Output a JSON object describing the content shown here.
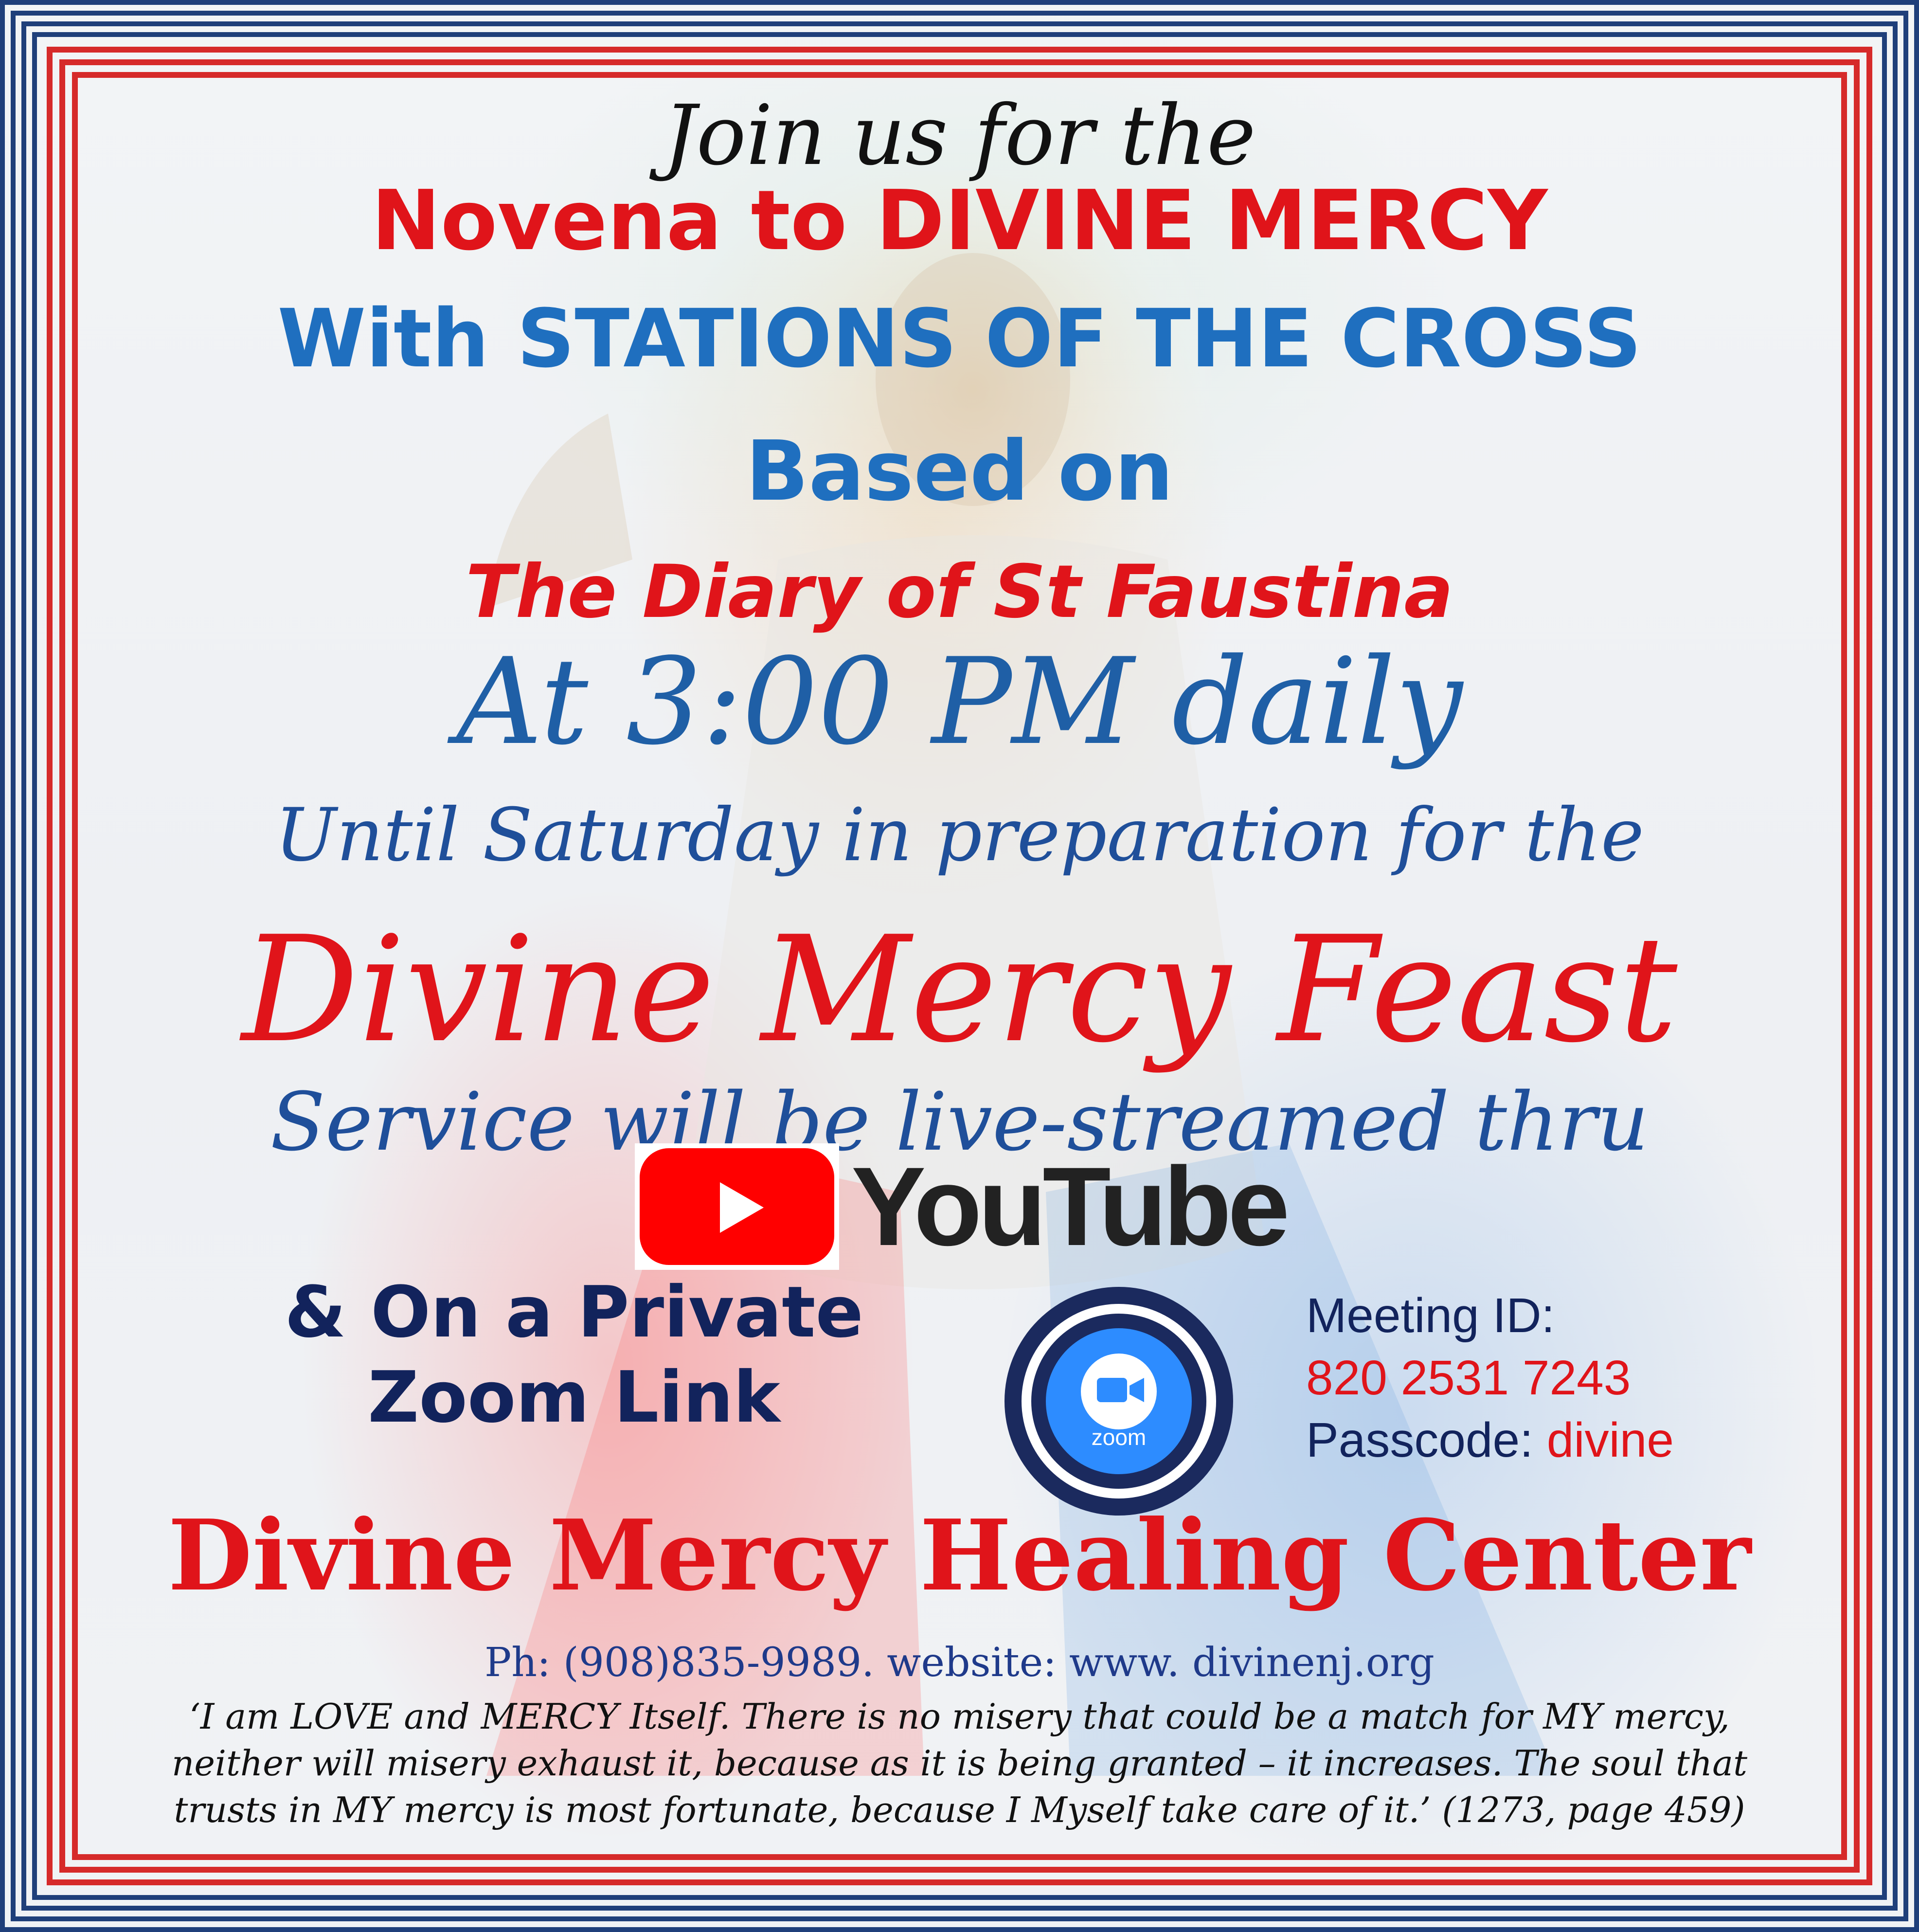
{
  "heading": {
    "join": "Join us for the",
    "novena": "Novena to DIVINE MERCY",
    "with": "With STATIONS OF THE CROSS",
    "based": "Based on",
    "diary": "The Diary of St Faustina",
    "time": "At 3:00 PM daily",
    "until": "Until Saturday in preparation for the",
    "feast": "Divine Mercy Feast",
    "service": "Service will be live-streamed thru"
  },
  "youtube": {
    "word": "YouTube",
    "icon": "youtube-play-icon",
    "color": "#ff0000"
  },
  "zoom": {
    "private_line1": "& On a Private",
    "private_line2": "Zoom Link",
    "logo_text": "zoom",
    "icon": "zoom-camera-icon",
    "meeting_label": "Meeting ID:",
    "meeting_id": "820 2531 7243",
    "passcode_label": "Passcode: ",
    "passcode": "divine"
  },
  "center": {
    "name": "Divine Mercy Healing Center",
    "contact": "Ph: (908)835-9989. website: www. divinenj.org"
  },
  "quote": {
    "line1": "‘I am LOVE and MERCY Itself.  There is no misery that could be a match for MY mercy,",
    "line2": "neither will misery exhaust it, because as it is being granted – it increases.  The soul that",
    "line3": "trusts in MY mercy is most fortunate, because I Myself take care of it.’ (1273, page 459)"
  },
  "colors": {
    "red": "#e0141a",
    "blue": "#1f6fbf",
    "navy": "#12235c",
    "border_navy": "#1f3f7a",
    "border_red": "#d62a2a"
  }
}
